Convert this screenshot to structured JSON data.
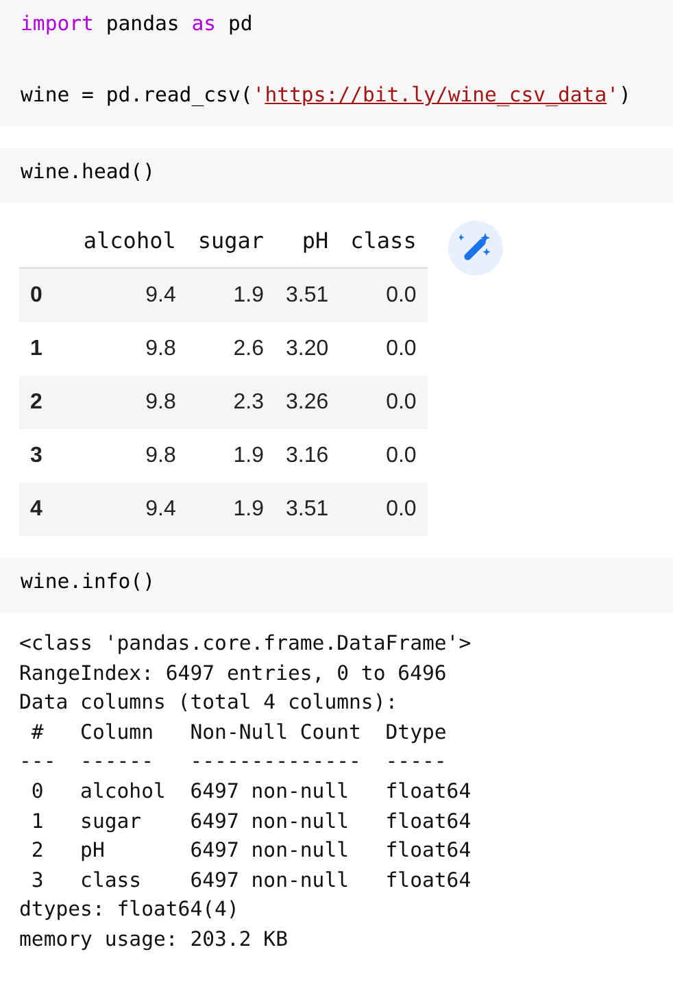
{
  "cells": [
    {
      "code": [
        [
          [
            {
              "kind": "keyword",
              "text": "import"
            },
            {
              "kind": "plain",
              "text": " pandas "
            },
            {
              "kind": "keyword",
              "text": "as"
            },
            {
              "kind": "plain",
              "text": " pd"
            }
          ]
        ],
        [
          [
            {
              "kind": "plain",
              "text": "wine = pd.read_csv("
            },
            {
              "kind": "string",
              "text": "'"
            },
            {
              "kind": "link",
              "text": "https://bit.ly/wine_csv_data"
            },
            {
              "kind": "string",
              "text": "'"
            },
            {
              "kind": "plain",
              "text": ")"
            }
          ]
        ]
      ]
    },
    {
      "code": [
        [
          [
            {
              "kind": "plain",
              "text": "wine.head()"
            }
          ]
        ]
      ],
      "output": {
        "kind": "table",
        "columns": [
          "alcohol",
          "sugar",
          "pH",
          "class"
        ],
        "rows": [
          {
            "index": "0",
            "cells": [
              "9.4",
              "1.9",
              "3.51",
              "0.0"
            ]
          },
          {
            "index": "1",
            "cells": [
              "9.8",
              "2.6",
              "3.20",
              "0.0"
            ]
          },
          {
            "index": "2",
            "cells": [
              "9.8",
              "2.3",
              "3.26",
              "0.0"
            ]
          },
          {
            "index": "3",
            "cells": [
              "9.8",
              "1.9",
              "3.16",
              "0.0"
            ]
          },
          {
            "index": "4",
            "cells": [
              "9.4",
              "1.9",
              "3.51",
              "0.0"
            ]
          }
        ]
      }
    },
    {
      "code": [
        [
          [
            {
              "kind": "plain",
              "text": "wine.info()"
            }
          ]
        ]
      ],
      "output": {
        "kind": "text",
        "lines": [
          "<class 'pandas.core.frame.DataFrame'>",
          "RangeIndex: 6497 entries, 0 to 6496",
          "Data columns (total 4 columns):",
          " #   Column   Non-Null Count  Dtype  ",
          "---  ------   --------------  -----  ",
          " 0   alcohol  6497 non-null   float64",
          " 1   sugar    6497 non-null   float64",
          " 2   pH       6497 non-null   float64",
          " 3   class    6497 non-null   float64",
          "dtypes: float64(4)",
          "memory usage: 203.2 KB"
        ]
      }
    }
  ]
}
